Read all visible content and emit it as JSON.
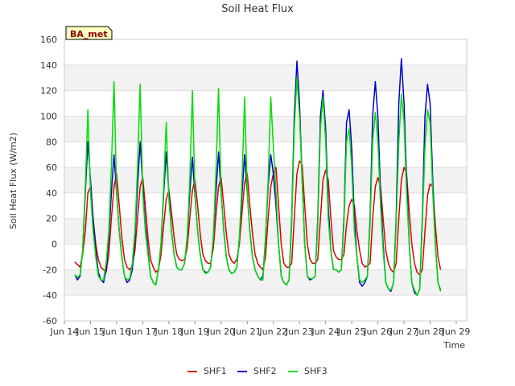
{
  "chart_data": {
    "type": "line",
    "title": "Soil Heat Flux",
    "xlabel": "Time",
    "ylabel": "Soil Heat Flux (W/m2)",
    "badge": "BA_met",
    "ylim": [
      -60,
      160
    ],
    "yticks": [
      -60,
      -40,
      -20,
      0,
      20,
      40,
      60,
      80,
      100,
      120,
      140,
      160
    ],
    "xlim": [
      13.6,
      29.0
    ],
    "xticks": [
      {
        "value": 13.6,
        "label": "Jun 14"
      },
      {
        "value": 14.6,
        "label": "Jun 15"
      },
      {
        "value": 15.6,
        "label": "Jun 16"
      },
      {
        "value": 16.6,
        "label": "Jun 17"
      },
      {
        "value": 17.6,
        "label": "Jun 18"
      },
      {
        "value": 18.6,
        "label": "Jun 19"
      },
      {
        "value": 19.6,
        "label": "Jun 20"
      },
      {
        "value": 20.6,
        "label": "Jun 21"
      },
      {
        "value": 21.6,
        "label": "Jun 22"
      },
      {
        "value": 22.6,
        "label": "Jun 23"
      },
      {
        "value": 23.6,
        "label": "Jun 24"
      },
      {
        "value": 24.6,
        "label": "Jun 25"
      },
      {
        "value": 25.6,
        "label": "Jun 26"
      },
      {
        "value": 26.6,
        "label": "Jun 27"
      },
      {
        "value": 27.6,
        "label": "Jun 28"
      },
      {
        "value": 28.6,
        "label": "Jun 29"
      }
    ],
    "grid": true,
    "legend_position": "bottom",
    "series": [
      {
        "name": "SHF1",
        "color": "#dd0000",
        "x": [
          14.0,
          14.1,
          14.2,
          14.3,
          14.4,
          14.5,
          14.6,
          14.7,
          14.8,
          14.9,
          15.0,
          15.1,
          15.2,
          15.3,
          15.4,
          15.5,
          15.6,
          15.7,
          15.8,
          15.9,
          16.0,
          16.1,
          16.2,
          16.3,
          16.4,
          16.5,
          16.6,
          16.7,
          16.8,
          16.9,
          17.0,
          17.1,
          17.2,
          17.3,
          17.4,
          17.5,
          17.6,
          17.7,
          17.8,
          17.9,
          18.0,
          18.1,
          18.2,
          18.3,
          18.4,
          18.5,
          18.6,
          18.7,
          18.8,
          18.9,
          19.0,
          19.1,
          19.2,
          19.3,
          19.4,
          19.5,
          19.6,
          19.7,
          19.8,
          19.9,
          20.0,
          20.1,
          20.2,
          20.3,
          20.4,
          20.5,
          20.6,
          20.7,
          20.8,
          20.9,
          21.0,
          21.1,
          21.2,
          21.3,
          21.4,
          21.5,
          21.6,
          21.7,
          21.8,
          21.9,
          22.0,
          22.1,
          22.2,
          22.3,
          22.4,
          22.5,
          22.6,
          22.7,
          22.8,
          22.9,
          23.0,
          23.1,
          23.2,
          23.3,
          23.4,
          23.5,
          23.6,
          23.7,
          23.8,
          23.9,
          24.0,
          24.1,
          24.2,
          24.3,
          24.4,
          24.5,
          24.6,
          24.7,
          24.8,
          24.9,
          25.0,
          25.1,
          25.2,
          25.3,
          25.4,
          25.5,
          25.6,
          25.7,
          25.8,
          25.9,
          26.0,
          26.1,
          26.2,
          26.3,
          26.4,
          26.5,
          26.6,
          26.7,
          26.8,
          26.9,
          27.0,
          27.1,
          27.2,
          27.3,
          27.4,
          27.5,
          27.6,
          27.7,
          27.8,
          27.9,
          28.0
        ],
        "values": [
          -14,
          -16,
          -18,
          -8,
          10,
          40,
          45,
          20,
          0,
          -12,
          -18,
          -20,
          -22,
          -8,
          20,
          45,
          55,
          30,
          5,
          -12,
          -18,
          -20,
          -17,
          -5,
          20,
          45,
          52,
          30,
          5,
          -12,
          -18,
          -22,
          -20,
          -8,
          15,
          35,
          42,
          25,
          5,
          -8,
          -12,
          -13,
          -12,
          -3,
          20,
          42,
          50,
          30,
          8,
          -8,
          -13,
          -15,
          -15,
          -3,
          22,
          45,
          52,
          30,
          8,
          -8,
          -13,
          -15,
          -12,
          0,
          25,
          48,
          55,
          30,
          8,
          -8,
          -15,
          -18,
          -20,
          -10,
          20,
          45,
          55,
          60,
          30,
          0,
          -15,
          -18,
          -18,
          -15,
          20,
          55,
          65,
          62,
          30,
          0,
          -12,
          -15,
          -15,
          -12,
          20,
          50,
          58,
          50,
          20,
          -5,
          -10,
          -12,
          -12,
          -8,
          15,
          30,
          35,
          30,
          10,
          -5,
          -15,
          -18,
          -17,
          -15,
          20,
          45,
          52,
          45,
          20,
          -5,
          -15,
          -20,
          -22,
          -15,
          20,
          50,
          60,
          55,
          25,
          0,
          -15,
          -22,
          -24,
          -20,
          10,
          38,
          47,
          45,
          15,
          -10,
          -20
        ]
      },
      {
        "name": "SHF2",
        "color": "#0000cc",
        "x": [
          14.0,
          14.1,
          14.2,
          14.3,
          14.4,
          14.5,
          14.6,
          14.7,
          14.8,
          14.9,
          15.0,
          15.1,
          15.2,
          15.3,
          15.4,
          15.5,
          15.6,
          15.7,
          15.8,
          15.9,
          16.0,
          16.1,
          16.2,
          16.3,
          16.4,
          16.5,
          16.6,
          16.7,
          16.8,
          16.9,
          17.0,
          17.1,
          17.2,
          17.3,
          17.4,
          17.5,
          17.6,
          17.7,
          17.8,
          17.9,
          18.0,
          18.1,
          18.2,
          18.3,
          18.4,
          18.5,
          18.6,
          18.7,
          18.8,
          18.9,
          19.0,
          19.1,
          19.2,
          19.3,
          19.4,
          19.5,
          19.6,
          19.7,
          19.8,
          19.9,
          20.0,
          20.1,
          20.2,
          20.3,
          20.4,
          20.5,
          20.6,
          20.7,
          20.8,
          20.9,
          21.0,
          21.1,
          21.2,
          21.3,
          21.4,
          21.5,
          21.6,
          21.7,
          21.8,
          21.9,
          22.0,
          22.1,
          22.2,
          22.3,
          22.4,
          22.5,
          22.6,
          22.7,
          22.8,
          22.9,
          23.0,
          23.1,
          23.2,
          23.3,
          23.4,
          23.5,
          23.6,
          23.7,
          23.8,
          23.9,
          24.0,
          24.1,
          24.2,
          24.3,
          24.4,
          24.5,
          24.6,
          24.7,
          24.8,
          24.9,
          25.0,
          25.1,
          25.2,
          25.3,
          25.4,
          25.5,
          25.6,
          25.7,
          25.8,
          25.9,
          26.0,
          26.1,
          26.2,
          26.3,
          26.4,
          26.5,
          26.6,
          26.7,
          26.8,
          26.9,
          27.0,
          27.1,
          27.2,
          27.3,
          27.4,
          27.5,
          27.6,
          27.7,
          27.8,
          27.9,
          28.0
        ],
        "values": [
          -24,
          -28,
          -25,
          -5,
          40,
          80,
          50,
          20,
          -5,
          -22,
          -28,
          -30,
          -20,
          5,
          40,
          70,
          40,
          10,
          -10,
          -25,
          -30,
          -28,
          -20,
          5,
          45,
          80,
          45,
          15,
          -5,
          -25,
          -30,
          -32,
          -20,
          0,
          40,
          72,
          40,
          10,
          -8,
          -18,
          -20,
          -20,
          -15,
          5,
          40,
          68,
          38,
          10,
          -8,
          -20,
          -22,
          -22,
          -18,
          5,
          40,
          72,
          40,
          10,
          -10,
          -20,
          -23,
          -22,
          -18,
          5,
          40,
          70,
          40,
          10,
          -10,
          -20,
          -25,
          -28,
          -25,
          5,
          45,
          70,
          55,
          30,
          0,
          -25,
          -30,
          -32,
          -28,
          20,
          100,
          143,
          110,
          50,
          0,
          -25,
          -28,
          -27,
          -25,
          20,
          100,
          120,
          90,
          30,
          -5,
          -20,
          -20,
          -22,
          -20,
          20,
          95,
          105,
          75,
          20,
          -10,
          -30,
          -33,
          -30,
          -25,
          20,
          100,
          127,
          100,
          40,
          0,
          -30,
          -35,
          -37,
          -30,
          20,
          110,
          145,
          110,
          50,
          0,
          -30,
          -38,
          -40,
          -35,
          20,
          100,
          125,
          110,
          50,
          0,
          -30,
          -36
        ]
      },
      {
        "name": "SHF3",
        "color": "#00dd00",
        "x": [
          14.0,
          14.1,
          14.2,
          14.3,
          14.4,
          14.5,
          14.6,
          14.7,
          14.8,
          14.9,
          15.0,
          15.1,
          15.2,
          15.3,
          15.4,
          15.5,
          15.6,
          15.7,
          15.8,
          15.9,
          16.0,
          16.1,
          16.2,
          16.3,
          16.4,
          16.5,
          16.6,
          16.7,
          16.8,
          16.9,
          17.0,
          17.1,
          17.2,
          17.3,
          17.4,
          17.5,
          17.6,
          17.7,
          17.8,
          17.9,
          18.0,
          18.1,
          18.2,
          18.3,
          18.4,
          18.5,
          18.6,
          18.7,
          18.8,
          18.9,
          19.0,
          19.1,
          19.2,
          19.3,
          19.4,
          19.5,
          19.6,
          19.7,
          19.8,
          19.9,
          20.0,
          20.1,
          20.2,
          20.3,
          20.4,
          20.5,
          20.6,
          20.7,
          20.8,
          20.9,
          21.0,
          21.1,
          21.2,
          21.3,
          21.4,
          21.5,
          21.6,
          21.7,
          21.8,
          21.9,
          22.0,
          22.1,
          22.2,
          22.3,
          22.4,
          22.5,
          22.6,
          22.7,
          22.8,
          22.9,
          23.0,
          23.1,
          23.2,
          23.3,
          23.4,
          23.5,
          23.6,
          23.7,
          23.8,
          23.9,
          24.0,
          24.1,
          24.2,
          24.3,
          24.4,
          24.5,
          24.6,
          24.7,
          24.8,
          24.9,
          25.0,
          25.1,
          25.2,
          25.3,
          25.4,
          25.5,
          25.6,
          25.7,
          25.8,
          25.9,
          26.0,
          26.1,
          26.2,
          26.3,
          26.4,
          26.5,
          26.6,
          26.7,
          26.8,
          26.9,
          27.0,
          27.1,
          27.2,
          27.3,
          27.4,
          27.5,
          27.6,
          27.7,
          27.8,
          27.9,
          28.0
        ],
        "values": [
          -24,
          -26,
          -24,
          -5,
          45,
          105,
          40,
          10,
          -10,
          -25,
          -28,
          -28,
          -15,
          10,
          60,
          127,
          40,
          10,
          -10,
          -25,
          -28,
          -27,
          -15,
          10,
          60,
          125,
          40,
          10,
          -8,
          -25,
          -30,
          -32,
          -20,
          0,
          45,
          95,
          35,
          10,
          -8,
          -18,
          -20,
          -20,
          -15,
          5,
          50,
          120,
          40,
          10,
          -8,
          -20,
          -23,
          -22,
          -18,
          5,
          55,
          122,
          40,
          10,
          -10,
          -20,
          -23,
          -22,
          -18,
          5,
          50,
          115,
          40,
          10,
          -10,
          -20,
          -25,
          -28,
          -28,
          5,
          50,
          115,
          76,
          40,
          0,
          -25,
          -30,
          -32,
          -28,
          15,
          90,
          130,
          100,
          50,
          0,
          -25,
          -27,
          -27,
          -25,
          15,
          90,
          115,
          80,
          20,
          -5,
          -20,
          -20,
          -22,
          -20,
          15,
          80,
          90,
          60,
          10,
          -10,
          -28,
          -30,
          -28,
          -25,
          15,
          80,
          103,
          80,
          30,
          -5,
          -30,
          -35,
          -36,
          -30,
          15,
          80,
          117,
          95,
          40,
          0,
          -30,
          -36,
          -40,
          -35,
          15,
          75,
          105,
          95,
          40,
          0,
          -30,
          -37
        ]
      }
    ]
  }
}
